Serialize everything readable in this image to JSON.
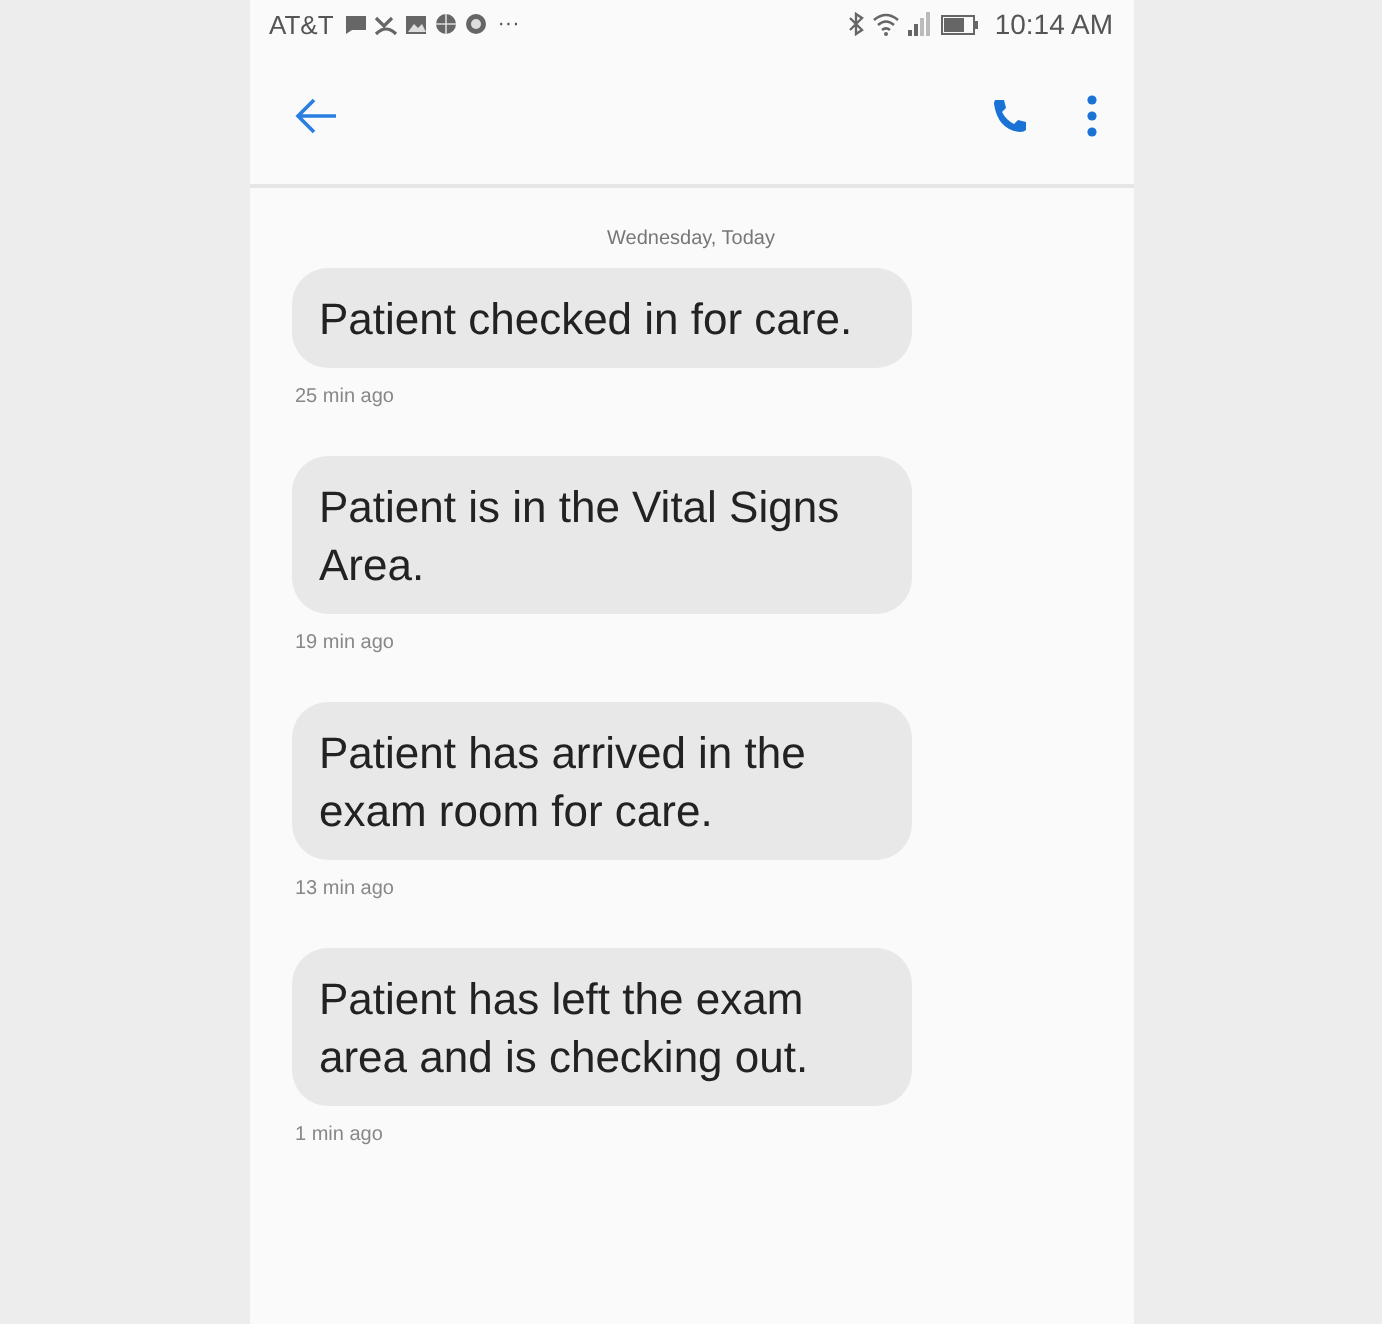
{
  "status_bar": {
    "carrier": "AT&T",
    "overflow": "···",
    "time": "10:14 AM"
  },
  "date_header": "Wednesday, Today",
  "messages": [
    {
      "text": "Patient checked in for care.",
      "time": "25 min ago"
    },
    {
      "text": "Patient is in the Vital Signs Area.",
      "time": "19 min ago"
    },
    {
      "text": "Patient has arrived in the exam room for care.",
      "time": "13 min ago"
    },
    {
      "text": "Patient has left the exam area and is checking out.",
      "time": "1 min ago"
    }
  ]
}
